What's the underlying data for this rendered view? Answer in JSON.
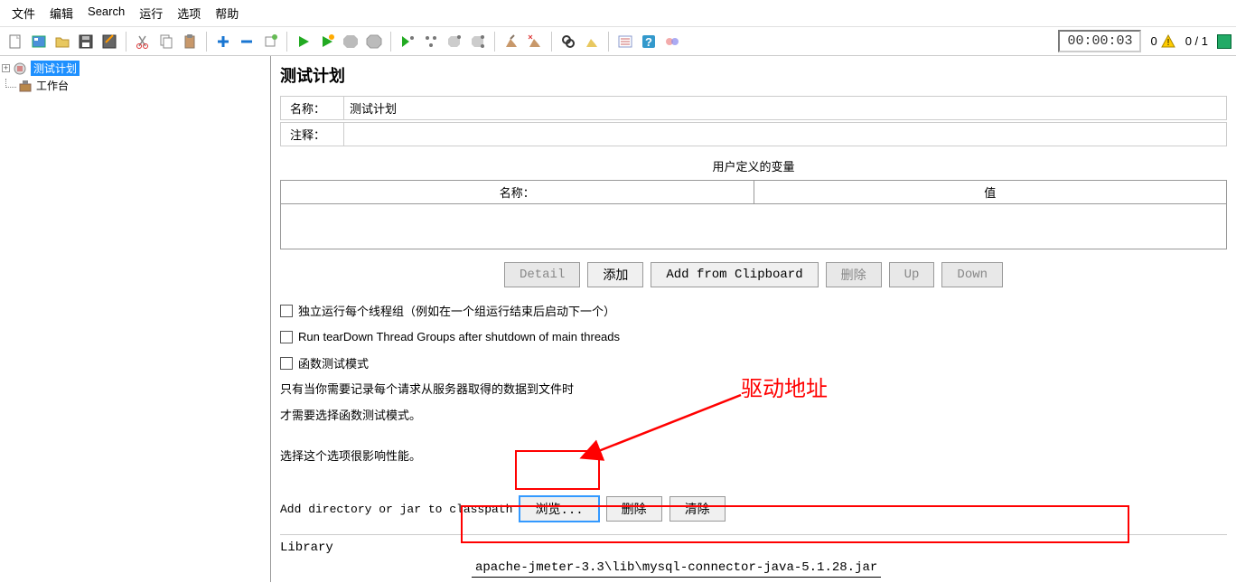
{
  "menu": [
    "文件",
    "编辑",
    "Search",
    "运行",
    "选项",
    "帮助"
  ],
  "timer": "00:00:03",
  "warn_count": "0",
  "thread_count": "0 / 1",
  "tree": {
    "plan": "测试计划",
    "workbench": "工作台"
  },
  "content": {
    "title": "测试计划",
    "name_label": "名称：",
    "name_value": "测试计划",
    "comment_label": "注释：",
    "comment_value": "",
    "vars_section": "用户定义的变量",
    "vars_col_name": "名称：",
    "vars_col_value": "值",
    "btn_detail": "Detail",
    "btn_add": "添加",
    "btn_clipboard": "Add from Clipboard",
    "btn_delete": "删除",
    "btn_up": "Up",
    "btn_down": "Down",
    "chk_independent": "独立运行每个线程组（例如在一个组运行结束后启动下一个）",
    "chk_teardown": "Run tearDown Thread Groups after shutdown of main threads",
    "chk_func_mode": "函数测试模式",
    "note1": "只有当你需要记录每个请求从服务器取得的数据到文件时",
    "note2": "才需要选择函数测试模式。",
    "note3": "选择这个选项很影响性能。",
    "classpath_label": "Add directory or jar to classpath",
    "btn_browse": "浏览...",
    "btn_delete2": "删除",
    "btn_clear": "清除",
    "library_header": "Library",
    "library_path": "apache-jmeter-3.3\\lib\\mysql-connector-java-5.1.28.jar"
  },
  "annotation": "驱动地址"
}
